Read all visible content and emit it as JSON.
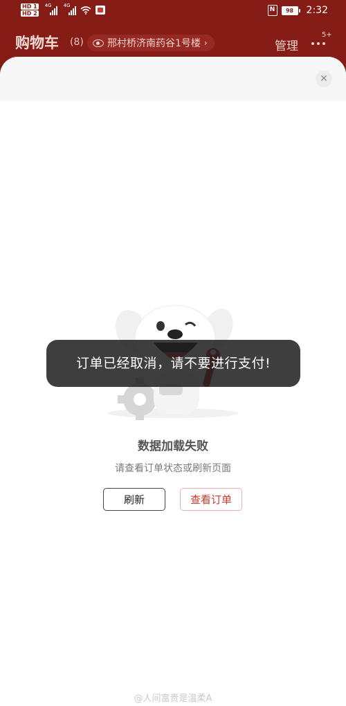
{
  "status_bar": {
    "hd1": "HD 1",
    "hd2": "HD 2",
    "net1": "4G",
    "net2": "4G",
    "nfc": "N",
    "battery": "98",
    "time": "2:32"
  },
  "header": {
    "title": "购物车",
    "count": "(8)",
    "address": "邢村桥济南药谷1号楼",
    "manage": "管理",
    "more_badge": "5+"
  },
  "sheet": {
    "close_icon": "close-icon",
    "toast": "订单已经取消，请不要进行支付!",
    "error_title": "数据加载失败",
    "error_subtitle": "请查看订单状态或刷新页面",
    "refresh_label": "刷新",
    "view_order_label": "查看订单",
    "watermark": "@人间富贵是温柔A"
  },
  "colors": {
    "brand_red": "#851d16",
    "accent_red": "#d03a2b"
  }
}
